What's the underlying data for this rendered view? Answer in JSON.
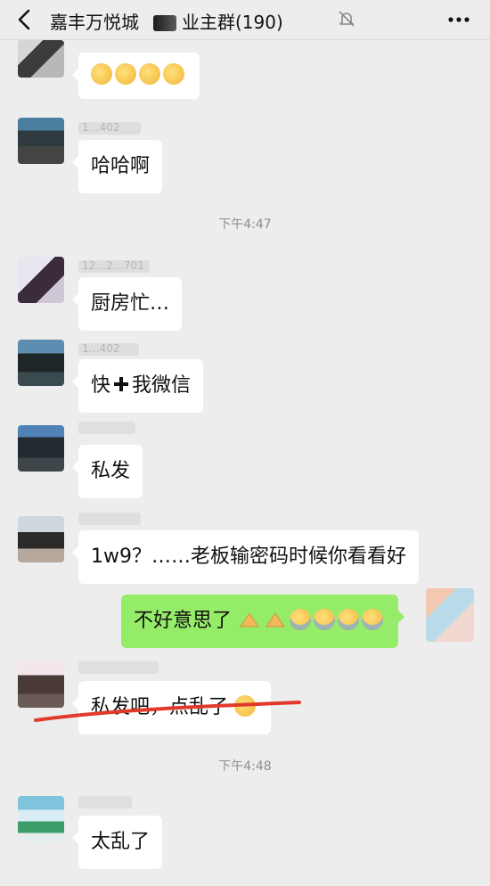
{
  "header": {
    "group_prefix": "嘉丰万悦城",
    "group_suffix": "业主群(190)",
    "back_icon": "back-chevron-icon",
    "mute_icon": "bell-muted-icon",
    "more_icon": "more-dots-icon"
  },
  "messages": [
    {
      "side": "left",
      "text": "",
      "emoji": [
        "thinking",
        "thinking",
        "thinking",
        "thinking"
      ]
    },
    {
      "side": "left",
      "nick_hint": "1…402",
      "text": "哈哈啊"
    },
    {
      "side": "left",
      "nick_hint": "12…2…701",
      "text": "厨房忙…"
    },
    {
      "side": "left",
      "nick_hint": "1…402",
      "text_a": "快",
      "text_b": "我微信"
    },
    {
      "side": "left",
      "text": "私发"
    },
    {
      "side": "left",
      "text": "1w9？……老板输密码时候你看看好"
    },
    {
      "side": "right",
      "text": "不好意思了",
      "emoji": [
        "folded-hands",
        "folded-hands",
        "laugh-cry",
        "laugh-cry",
        "laugh-cry",
        "laugh-cry"
      ]
    },
    {
      "side": "left",
      "text": "私发吧，点乱了",
      "emoji": [
        "grinning"
      ]
    },
    {
      "side": "left",
      "text": "太乱了"
    }
  ],
  "timestamps": [
    "下午4:47",
    "下午4:48"
  ],
  "colors": {
    "background": "#ededed",
    "my_bubble": "#95ec69",
    "other_bubble": "#ffffff",
    "highlight_underline": "#e23a2a"
  }
}
